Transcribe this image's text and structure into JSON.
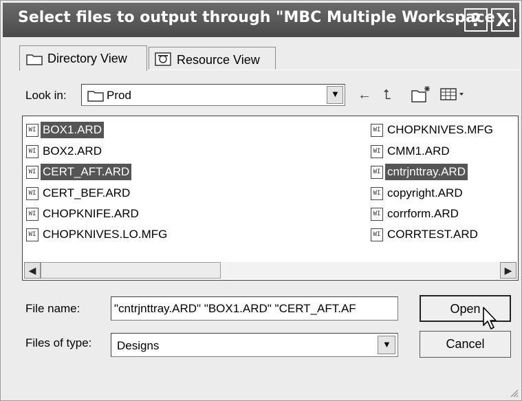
{
  "window": {
    "title": "Select files to output through \"MBC Multiple Workspace ...",
    "help_label": "?",
    "close_label": "X"
  },
  "tabs": [
    {
      "label": "Directory View",
      "icon": "folder-icon",
      "active": true
    },
    {
      "label": "Resource View",
      "icon": "resource-icon",
      "active": false
    }
  ],
  "lookin": {
    "label": "Look in:",
    "value": "Prod",
    "dropdown_arrow": "▼"
  },
  "toolbar": {
    "back_icon": "←",
    "up_icon": "⮤",
    "newfolder_icon": "✶",
    "view_icon": "▦▾"
  },
  "files": {
    "left": [
      {
        "name": "BOX1.ARD",
        "selected": true
      },
      {
        "name": "BOX2.ARD",
        "selected": false
      },
      {
        "name": "CERT_AFT.ARD",
        "selected": true
      },
      {
        "name": "CERT_BEF.ARD",
        "selected": false
      },
      {
        "name": "CHOPKNIFE.ARD",
        "selected": false
      },
      {
        "name": "CHOPKNIVES.LO.MFG",
        "selected": false
      }
    ],
    "right": [
      {
        "name": "CHOPKNIVES.MFG",
        "selected": false
      },
      {
        "name": "CMM1.ARD",
        "selected": false
      },
      {
        "name": "cntrjnttray.ARD",
        "selected": true
      },
      {
        "name": "copyright.ARD",
        "selected": false
      },
      {
        "name": "corrform.ARD",
        "selected": false
      },
      {
        "name": "CORRTEST.ARD",
        "selected": false
      }
    ],
    "file_icon_glyph": "WI"
  },
  "scroll": {
    "left_arrow": "◀",
    "right_arrow": "▶"
  },
  "filename": {
    "label": "File name:",
    "value": "\"cntrjnttray.ARD\" \"BOX1.ARD\" \"CERT_AFT.AF"
  },
  "filetype": {
    "label": "Files of type:",
    "value": "Designs",
    "dropdown_arrow": "▼"
  },
  "buttons": {
    "open": "Open",
    "cancel": "Cancel"
  },
  "colors": {
    "titlebar": "#555555",
    "selection": "#555555"
  }
}
